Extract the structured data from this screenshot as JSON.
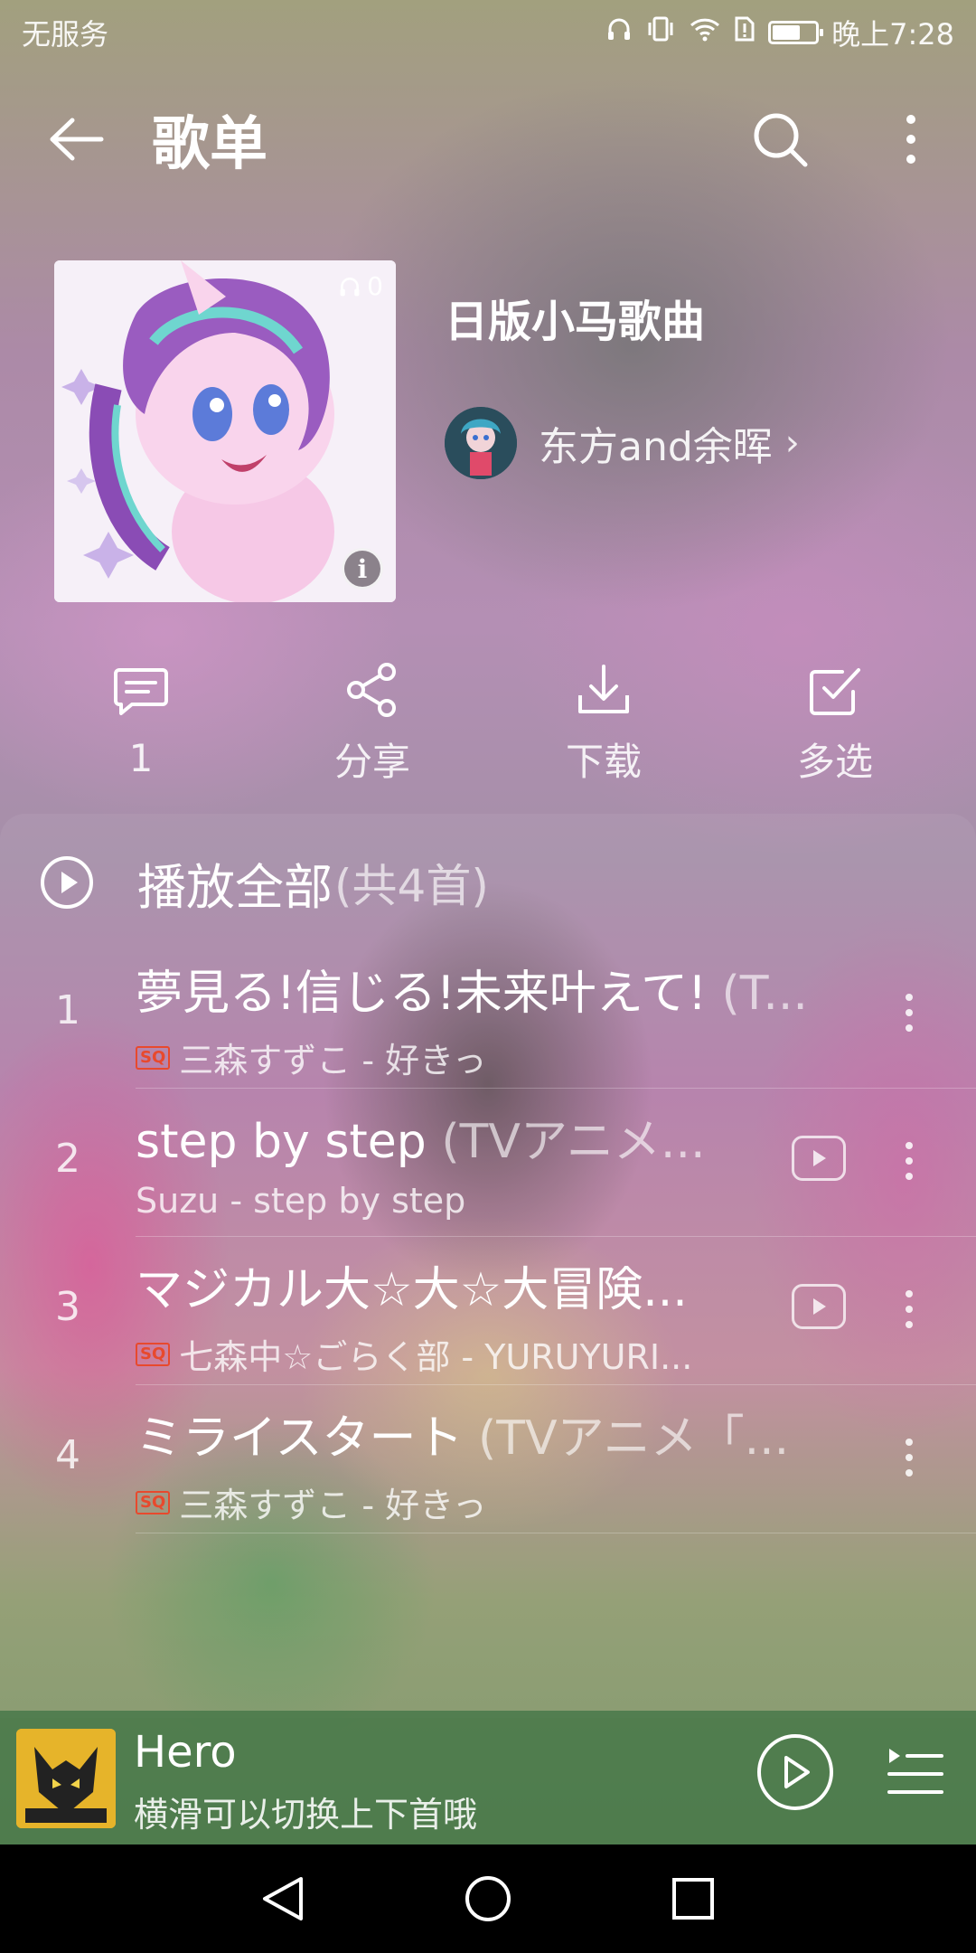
{
  "status_bar": {
    "carrier": "无服务",
    "time": "晚上7:28",
    "battery_level": 0.6
  },
  "header": {
    "title": "歌单"
  },
  "playlist": {
    "name": "日版小马歌曲",
    "play_count": "0",
    "creator": "东方and余晖",
    "creator_chevron": "›"
  },
  "actions": [
    {
      "label": "1",
      "icon": "comment-icon"
    },
    {
      "label": "分享",
      "icon": "share-icon"
    },
    {
      "label": "下载",
      "icon": "download-icon"
    },
    {
      "label": "多选",
      "icon": "multi-select-icon"
    }
  ],
  "play_all": {
    "label": "播放全部",
    "count": "(共4首)"
  },
  "tracks": [
    {
      "num": "1",
      "title": "夢見る!信じる!未来叶えて!",
      "title_extra": " (T...",
      "quality": "SQ",
      "subtitle": "三森すずこ - 好きっ",
      "has_mv": false
    },
    {
      "num": "2",
      "title": "step by step",
      "title_extra": " (TVアニメ...",
      "quality": "",
      "subtitle": "Suzu - step by step",
      "has_mv": true
    },
    {
      "num": "3",
      "title": "マジカル大☆大☆大冒険...",
      "title_extra": "",
      "quality": "SQ",
      "subtitle": "七森中☆ごらく部 - YURUYURI...",
      "has_mv": true
    },
    {
      "num": "4",
      "title": "ミライスタート",
      "title_extra": " (TVアニメ「...",
      "quality": "SQ",
      "subtitle": "三森すずこ - 好きっ",
      "has_mv": false
    }
  ],
  "mini_player": {
    "song": "Hero",
    "hint": "横滑可以切换上下首哦"
  },
  "colors": {
    "sq_badge": "#e8492d",
    "mini_player_bg": "#46784a"
  }
}
